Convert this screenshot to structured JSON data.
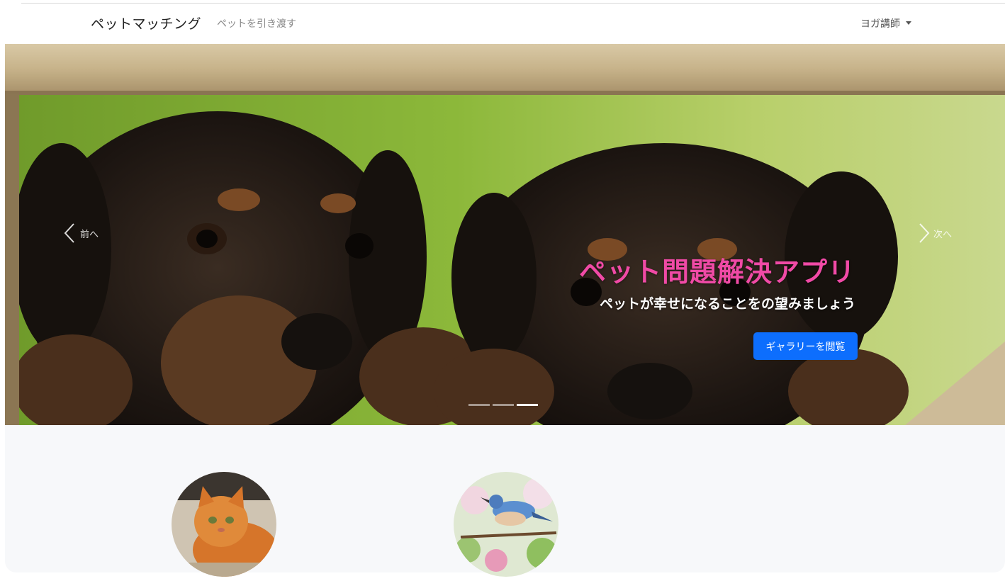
{
  "navbar": {
    "brand": "ペットマッチング",
    "link": "ペットを引き渡す",
    "user_menu": "ヨガ講師"
  },
  "carousel": {
    "prev_label": "前へ",
    "next_label": "次へ",
    "caption_title": "ペット問題解決アプリ",
    "caption_subtitle": "ペットが幸せになることをの望みましょう",
    "button_label": "ギャラリーを閲覧",
    "slide_count": 3,
    "active_slide": 3,
    "colors": {
      "title": "#f04aa6",
      "button": "#0d6efd"
    }
  },
  "featured_pets": [
    {
      "kind": "cat-photo"
    },
    {
      "kind": "bird-photo"
    }
  ]
}
